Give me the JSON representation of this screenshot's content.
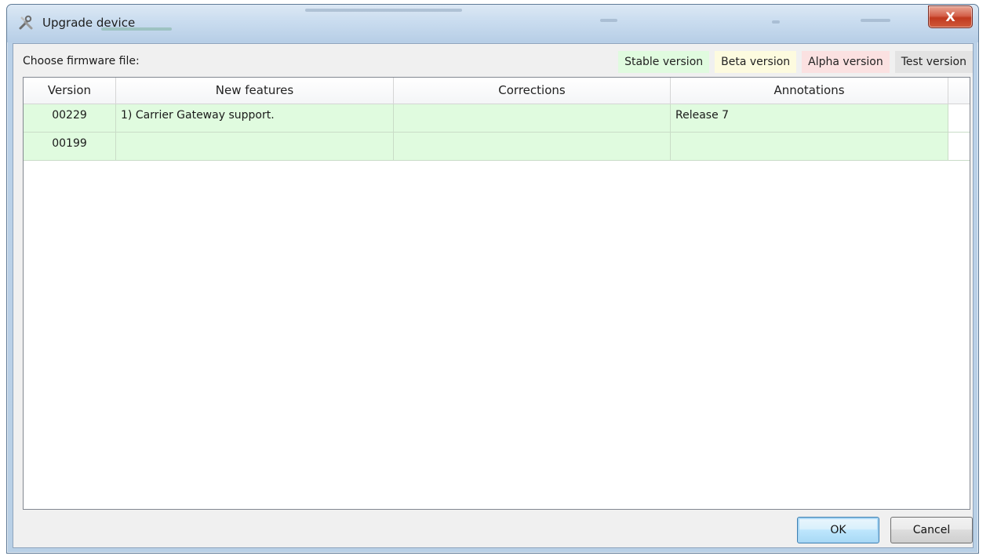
{
  "window": {
    "title": "Upgrade device",
    "close_glyph": "X"
  },
  "dialog": {
    "choose_label": "Choose firmware file:",
    "legend": [
      {
        "label": "Stable version",
        "color": "#e0fbdf"
      },
      {
        "label": "Beta version",
        "color": "#fdfbdf"
      },
      {
        "label": "Alpha version",
        "color": "#fbe1e1"
      },
      {
        "label": "Test version",
        "color": "#e3e3e3"
      }
    ]
  },
  "table": {
    "columns": [
      "Version",
      "New features",
      "Corrections",
      "Annotations"
    ],
    "rows": [
      {
        "version": "00229",
        "features": "1) Carrier Gateway support.",
        "corrections": "",
        "annotations": "Release 7",
        "color": "#e0fbdf"
      },
      {
        "version": "00199",
        "features": "",
        "corrections": "",
        "annotations": "",
        "color": "#e0fbdf"
      }
    ]
  },
  "buttons": {
    "ok": "OK",
    "cancel": "Cancel"
  },
  "icons": {
    "title": "tools-icon",
    "close": "close-icon"
  }
}
